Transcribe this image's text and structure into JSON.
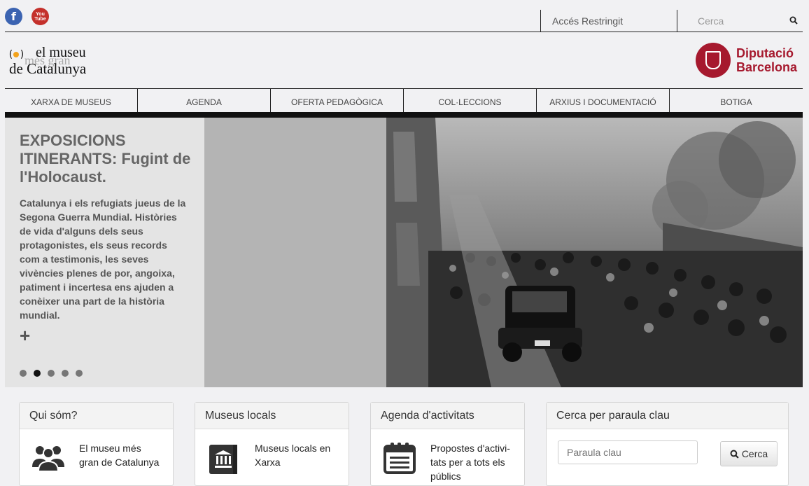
{
  "topbar": {
    "facebook_icon": "facebook-icon",
    "youtube_label_top": "You",
    "youtube_label_bottom": "Tube",
    "restricted_access": "Accés Restringit",
    "search_placeholder": "Cerca"
  },
  "header": {
    "logo_line1": "el museu",
    "logo_line2": "més gran",
    "logo_line3": "de Catalunya",
    "partner_line1": "Diputació",
    "partner_line2": "Barcelona"
  },
  "nav": {
    "items": [
      {
        "label": "XARXA DE MUSEUS"
      },
      {
        "label": "AGENDA"
      },
      {
        "label": "OFERTA PEDAGÒGICA"
      },
      {
        "label": "COL·LECCIONS"
      },
      {
        "label": "ARXIUS I DOCUMENTACIÓ"
      },
      {
        "label": "BOTIGA"
      }
    ]
  },
  "hero": {
    "title": "EXPOSICIONS ITINERANTS: Fugint de l'Holocaust.",
    "body": "Catalunya i els refugiats jueus de la Segona Guerra Mundial. Històries de vida d'alguns dels seus protagonistes, els seus records com a testimonis, les seves vivències plenes de por, angoixa, patiment i incertesa ens ajuden a conèixer una part de la història mundial.",
    "more": "+",
    "slides": 5,
    "active_slide": 2
  },
  "cards": [
    {
      "title": "Qui sóm?",
      "text": "El museu més gran de Catalunya",
      "icon": "people-icon"
    },
    {
      "title": "Museus locals",
      "text": "Museus locals en Xarxa",
      "icon": "museum-book-icon"
    },
    {
      "title": "Agenda d'activitats",
      "text": "Propostes d'activi-tats per a tots els públics",
      "icon": "calendar-icon"
    }
  ],
  "keyword_search": {
    "title": "Cerca per paraula clau",
    "placeholder": "Paraula clau",
    "button": "Cerca"
  },
  "colors": {
    "accent": "#a6192e",
    "logo_dot": "#f2a21c",
    "facebook": "#3b63b1",
    "youtube": "#c4302b"
  }
}
